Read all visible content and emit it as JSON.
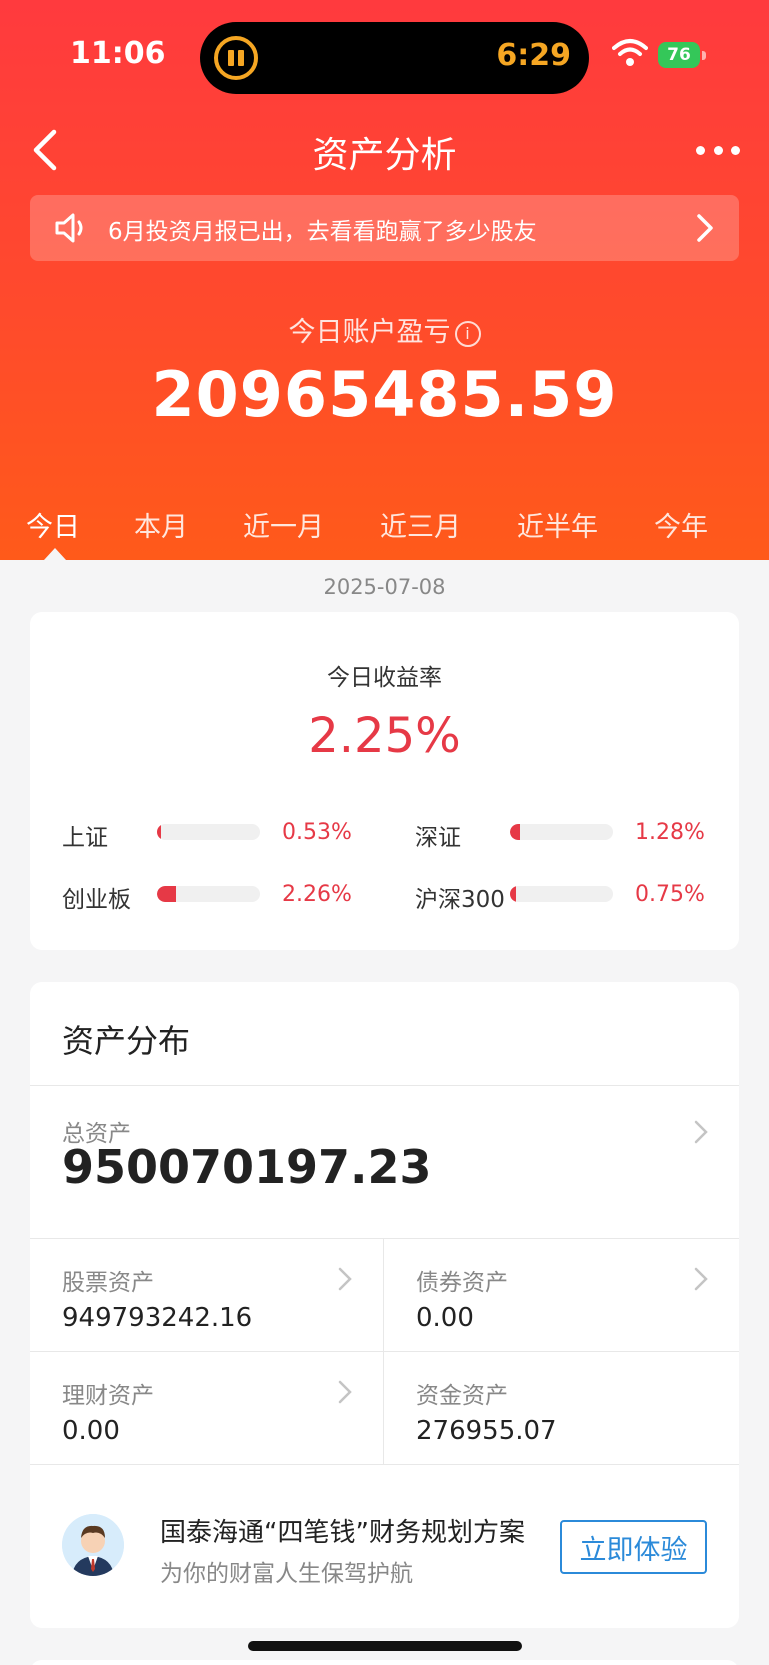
{
  "status_bar": {
    "time": "11:06",
    "activity_timer": "6:29",
    "battery": "76"
  },
  "nav": {
    "title": "资产分析"
  },
  "notice": {
    "text": "6月投资月报已出，去看看跑赢了多少股友"
  },
  "pnl": {
    "label": "今日账户盈亏",
    "info_icon": "i",
    "value": "20965485.59"
  },
  "tabs": [
    {
      "label": "今日",
      "active": true
    },
    {
      "label": "本月",
      "active": false
    },
    {
      "label": "近一月",
      "active": false
    },
    {
      "label": "近三月",
      "active": false
    },
    {
      "label": "近半年",
      "active": false
    },
    {
      "label": "今年",
      "active": false
    }
  ],
  "date": "2025-07-08",
  "rate_card": {
    "title": "今日收益率",
    "value": "2.25%",
    "indices": [
      {
        "name": "上证",
        "value": "0.53%",
        "fill_fraction": 0.04
      },
      {
        "name": "深证",
        "value": "1.28%",
        "fill_fraction": 0.1
      },
      {
        "name": "创业板",
        "value": "2.26%",
        "fill_fraction": 0.18
      },
      {
        "name": "沪深300",
        "value": "0.75%",
        "fill_fraction": 0.06
      }
    ]
  },
  "asset_card": {
    "title": "资产分布",
    "total": {
      "label": "总资产",
      "value": "950070197.23"
    },
    "stock": {
      "label": "股票资产",
      "value": "949793242.16"
    },
    "bond": {
      "label": "债券资产",
      "value": "0.00"
    },
    "wealth": {
      "label": "理财资产",
      "value": "0.00"
    },
    "cash": {
      "label": "资金资产",
      "value": "276955.07"
    },
    "promo": {
      "title": "国泰海通“四笔钱”财务规划方案",
      "subtitle": "为你的财富人生保驾护航",
      "button": "立即体验"
    }
  },
  "colors": {
    "hero_top": "#ff3a3e",
    "hero_bottom": "#ff5a1a",
    "gain": "#e63946",
    "link": "#2b8ad9"
  }
}
